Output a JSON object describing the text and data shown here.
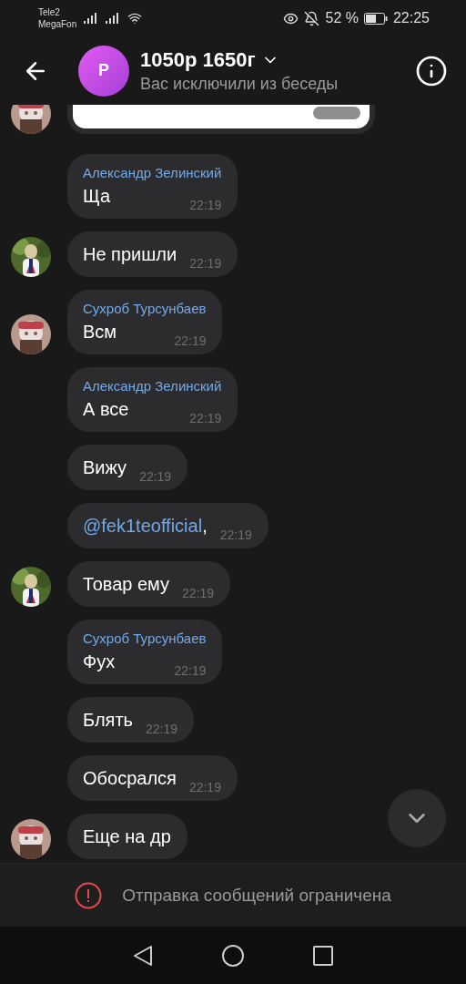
{
  "status_bar": {
    "carriers": [
      "Tele2",
      "MegaFon"
    ],
    "battery": "52 %",
    "time": "22:25"
  },
  "header": {
    "avatar_letter": "Р",
    "title": "1050р 1650г",
    "subtitle": "Вас исключили из беседы"
  },
  "messages": [
    {
      "kind": "media",
      "avatar": true
    },
    {
      "kind": "text",
      "author": "Александр Зелинский",
      "text": "Ща",
      "time": "22:19",
      "avatar": false
    },
    {
      "kind": "text",
      "text": "Не пришли",
      "time": "22:19",
      "avatar": true
    },
    {
      "kind": "text",
      "author": "Сухроб Турсунбаев",
      "text": "Всм",
      "time": "22:19",
      "avatar": true
    },
    {
      "kind": "text",
      "author": "Александр Зелинский",
      "text": "А все",
      "time": "22:19",
      "avatar": false
    },
    {
      "kind": "text",
      "text": "Вижу",
      "time": "22:19",
      "avatar": false
    },
    {
      "kind": "mention",
      "mention": "@fek1teofficial",
      "text": ",",
      "time": "22:19",
      "avatar": false
    },
    {
      "kind": "text",
      "text": "Товар ему",
      "time": "22:19",
      "avatar": true
    },
    {
      "kind": "text",
      "author": "Сухроб Турсунбаев",
      "text": "Фух",
      "time": "22:19",
      "avatar": false
    },
    {
      "kind": "text",
      "text": "Блять",
      "time": "22:19",
      "avatar": false
    },
    {
      "kind": "text",
      "text": "Обосрался",
      "time": "22:19",
      "avatar": false
    },
    {
      "kind": "text",
      "text": "Еще на др",
      "avatar": true
    }
  ],
  "banner": {
    "text": "Отправка сообщений ограничена"
  }
}
